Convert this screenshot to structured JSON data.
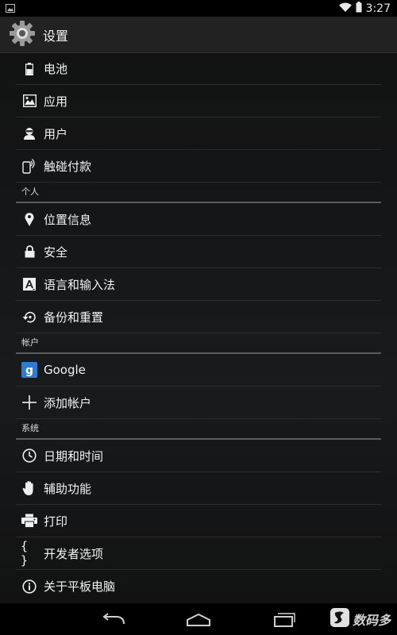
{
  "status_bar": {
    "time": "3:27",
    "icons": [
      "image-notification-icon",
      "wifi-icon",
      "battery-icon"
    ]
  },
  "action_bar": {
    "title": "设置",
    "icon": "settings-gear-icon"
  },
  "items": {
    "battery": "电池",
    "apps": "应用",
    "users": "用户",
    "nfc": "触碰付款",
    "location": "位置信息",
    "security": "安全",
    "language": "语言和输入法",
    "backup": "备份和重置",
    "google": "Google",
    "add_account": "添加帐户",
    "datetime": "日期和时间",
    "accessibility": "辅助功能",
    "print": "打印",
    "developer": "开发者选项",
    "about": "关于平板电脑"
  },
  "headers": {
    "personal": "个人",
    "accounts": "帐户",
    "system": "系统"
  },
  "google_icon_letter": "g",
  "developer_icon_text": "{ }",
  "nav_bar": {
    "buttons": [
      "back-icon",
      "home-icon",
      "recents-icon"
    ]
  },
  "watermark": {
    "text": "数码多"
  },
  "colors": {
    "background": "#181a1c",
    "action_bar": "#222222",
    "divider": "#2a2c2e",
    "header_line": "#5a5c5e",
    "google_blue": "#2f7bd3"
  }
}
